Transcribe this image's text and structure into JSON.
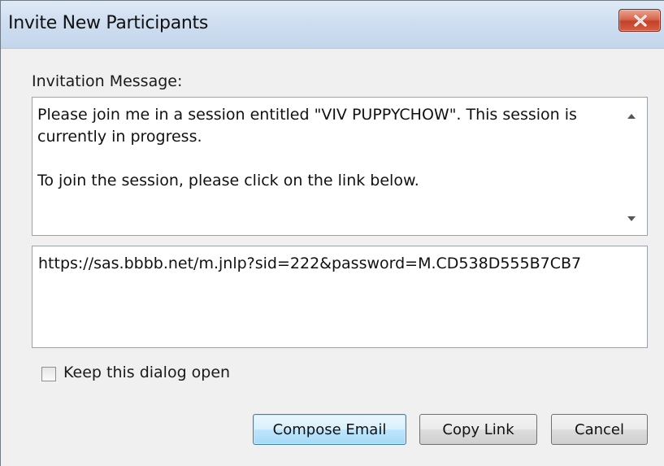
{
  "window": {
    "title": "Invite New Participants",
    "close_icon": "close-icon"
  },
  "message": {
    "label": "Invitation Message:",
    "text": "Please join me in a session entitled \"VIV PUPPYCHOW\". This session is\ncurrently in progress.\n\nTo join the session, please click on the link below."
  },
  "link": {
    "url": "https://sas.bbbb.net/m.jnlp?sid=222&password=M.CD538D555B7CB7"
  },
  "options": {
    "keep_open_label": "Keep this dialog open",
    "keep_open_checked": false
  },
  "buttons": {
    "compose_email": "Compose Email",
    "copy_link": "Copy Link",
    "cancel": "Cancel"
  },
  "colors": {
    "titlebar": "#cfdef0",
    "close_button": "#c3412a",
    "primary_button": "#bee6fd",
    "dialog_background": "#f0f0f0"
  }
}
